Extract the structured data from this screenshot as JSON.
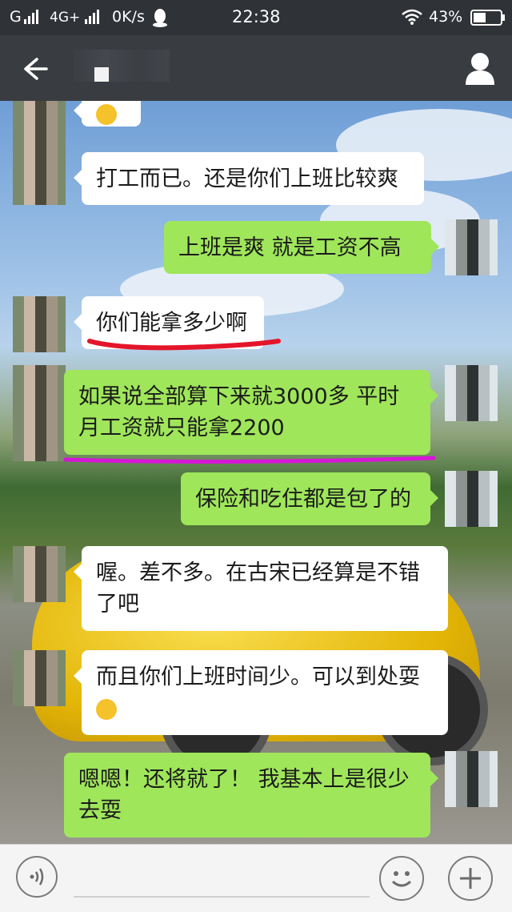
{
  "status_bar": {
    "carrier": "G",
    "network": "4G+",
    "speed": "0K/s",
    "time": "22:38",
    "battery": "43%",
    "icons": [
      "signal-icon",
      "notification-penguin-icon",
      "wifi-icon",
      "battery-icon"
    ]
  },
  "title_bar": {
    "back_icon": "back-arrow-icon",
    "profile_icon": "profile-icon"
  },
  "messages": [
    {
      "side": "in",
      "text": "打工而已。还是你们上班比较爽"
    },
    {
      "side": "out",
      "text": "上班是爽   就是工资不高"
    },
    {
      "side": "in",
      "text": "你们能拿多少啊"
    },
    {
      "side": "out",
      "text": "如果说全部算下来就3000多   平时月工资就只能拿2200"
    },
    {
      "side": "out",
      "text": "保险和吃住都是包了的"
    },
    {
      "side": "in",
      "text": "喔。差不多。在古宋已经算是不错了吧"
    },
    {
      "side": "in",
      "text": "而且你们上班时间少。可以到处耍"
    },
    {
      "side": "out",
      "text": "嗯嗯！还将就了！    我基本上是很少去耍"
    }
  ],
  "annotation_colors": {
    "red_underline": "#e4152a",
    "magenta_underline": "#d616d6"
  },
  "input_bar": {
    "voice_icon": "voice-icon",
    "emoji_icon": "emoji-icon",
    "plus_icon": "plus-icon"
  }
}
